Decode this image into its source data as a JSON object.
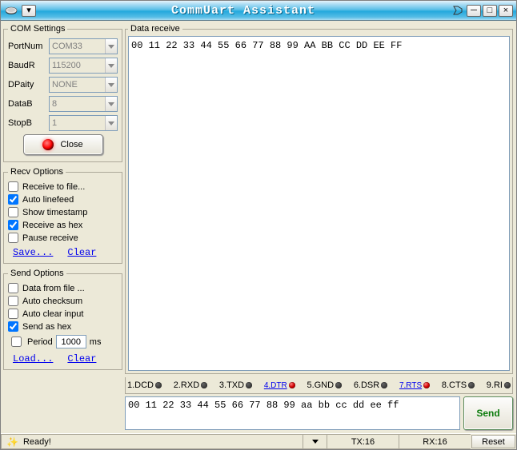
{
  "titlebar": {
    "title": "CommUart Assistant",
    "icons": {
      "app": "modem-icon",
      "pin": "pin-icon",
      "min": "─",
      "max": "□",
      "close": "×",
      "menu": "▾"
    }
  },
  "com_settings": {
    "legend": "COM Settings",
    "fields": {
      "PortNum": {
        "label": "PortNum",
        "value": "COM33"
      },
      "BaudR": {
        "label": "BaudR",
        "value": "115200"
      },
      "DPaity": {
        "label": "DPaity",
        "value": "NONE"
      },
      "DataB": {
        "label": "DataB",
        "value": "8"
      },
      "StopB": {
        "label": "StopB",
        "value": "1"
      }
    },
    "close_btn": "Close"
  },
  "recv_options": {
    "legend": "Recv Options",
    "items": [
      {
        "label": "Receive to file...",
        "checked": false
      },
      {
        "label": "Auto linefeed",
        "checked": true
      },
      {
        "label": "Show timestamp",
        "checked": false
      },
      {
        "label": "Receive as hex",
        "checked": true
      },
      {
        "label": "Pause receive",
        "checked": false
      }
    ],
    "save": "Save...",
    "clear": "Clear"
  },
  "send_options": {
    "legend": "Send Options",
    "items": [
      {
        "label": "Data from file ...",
        "checked": false
      },
      {
        "label": "Auto checksum",
        "checked": false
      },
      {
        "label": "Auto clear input",
        "checked": false
      },
      {
        "label": "Send as hex",
        "checked": true
      }
    ],
    "period_checked": false,
    "period_label": "Period",
    "period_value": "1000",
    "period_unit": "ms",
    "load": "Load...",
    "clear": "Clear"
  },
  "data_receive": {
    "legend": "Data receive",
    "content": "00 11 22 33 44 55 66 77 88 99 AA BB CC DD EE FF "
  },
  "signals": [
    {
      "name": "1.DCD",
      "link": false,
      "on": false
    },
    {
      "name": "2.RXD",
      "link": false,
      "on": false
    },
    {
      "name": "3.TXD",
      "link": false,
      "on": false
    },
    {
      "name": "4.DTR",
      "link": true,
      "on": true
    },
    {
      "name": "5.GND",
      "link": false,
      "on": false
    },
    {
      "name": "6.DSR",
      "link": false,
      "on": false
    },
    {
      "name": "7.RTS",
      "link": true,
      "on": true
    },
    {
      "name": "8.CTS",
      "link": false,
      "on": false
    },
    {
      "name": "9.RI",
      "link": false,
      "on": false
    }
  ],
  "send": {
    "input": "00 11 22 33 44 55 66 77 88 99 aa bb cc dd ee ff",
    "button": "Send"
  },
  "statusbar": {
    "ready": "Ready!",
    "tx": "TX:16",
    "rx": "RX:16",
    "reset": "Reset"
  }
}
